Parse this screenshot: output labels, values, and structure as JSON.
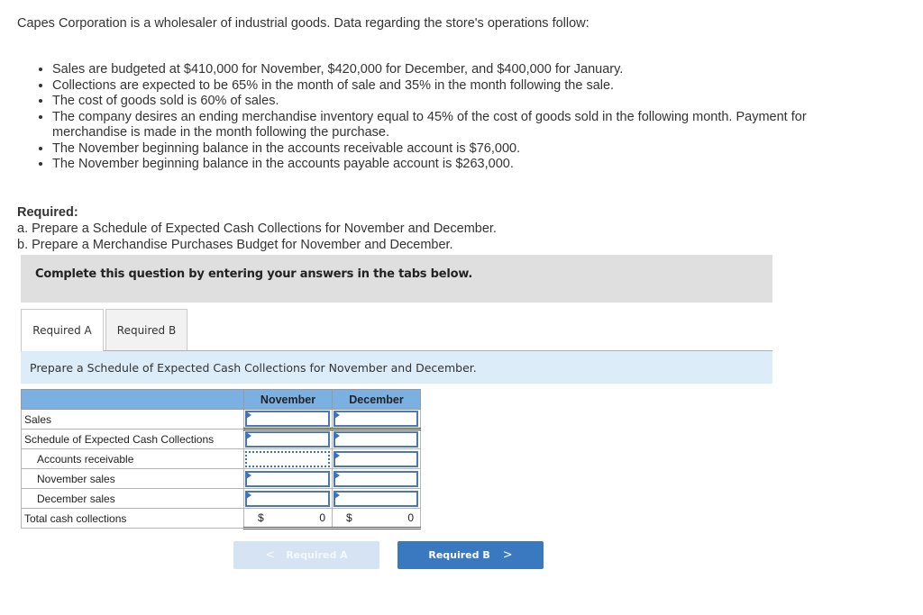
{
  "intro": "Capes Corporation is a wholesaler of industrial goods. Data regarding the store's operations follow:",
  "bullets": [
    "Sales are budgeted at $410,000 for November, $420,000 for December, and $400,000 for January.",
    "Collections are expected to be 65% in the month of sale and 35% in the month following the sale.",
    "The cost of goods sold is 60% of sales.",
    "The company desires an ending merchandise inventory equal to 45% of the cost of goods sold in the following month. Payment for merchandise is made in the month following the purchase.",
    "The November beginning balance in the accounts receivable account is $76,000.",
    "The November beginning balance in the accounts payable account is $263,000."
  ],
  "required": {
    "title": "Required:",
    "a": "a. Prepare a Schedule of Expected Cash Collections for November and December.",
    "b": "b. Prepare a Merchandise Purchases Budget for November and December."
  },
  "instruction": "Complete this question by entering your answers in the tabs below.",
  "tabs": [
    {
      "label": "Required A",
      "active": true
    },
    {
      "label": "Required B",
      "active": false
    }
  ],
  "prompt": "Prepare a Schedule of Expected Cash Collections for November and December.",
  "table": {
    "columns": [
      "",
      "November",
      "December"
    ],
    "rows": [
      {
        "label": "Sales",
        "indent": false,
        "november": "",
        "december": ""
      },
      {
        "label": "Schedule of Expected Cash Collections",
        "indent": false,
        "november": "",
        "december": ""
      },
      {
        "label": "Accounts receivable",
        "indent": true,
        "november": "",
        "december": ""
      },
      {
        "label": "November sales",
        "indent": true,
        "november": "",
        "december": ""
      },
      {
        "label": "December sales",
        "indent": true,
        "november": "",
        "december": ""
      }
    ],
    "total": {
      "label": "Total cash collections",
      "currency": "$",
      "november": "0",
      "december": "0"
    }
  },
  "nav": {
    "prev_label": "Required A",
    "next_label": "Required B",
    "prev_icon": "chevron-left-icon",
    "next_icon": "chevron-right-icon"
  },
  "colors": {
    "header_blue": "#7bb0e3",
    "next_button": "#3a78bf",
    "prev_button_disabled": "#d6e3f2",
    "prompt_band": "#dcecf9",
    "instruction_band": "#dfdfdf"
  }
}
